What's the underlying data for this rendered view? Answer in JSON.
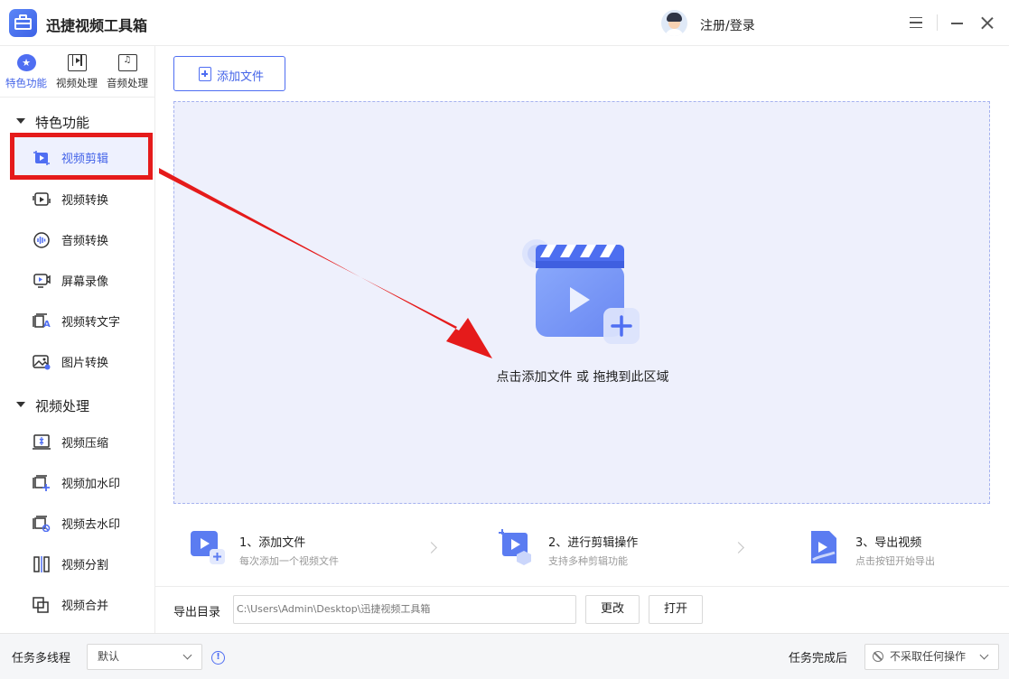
{
  "app": {
    "title": "迅捷视频工具箱",
    "login": "注册/登录"
  },
  "colors": {
    "accent": "#4f6ef2",
    "dropzone_bg": "#eef0fc",
    "annotation_red": "#e51b1b"
  },
  "topnav": [
    {
      "label": "特色功能",
      "icon": "star-icon",
      "active": true
    },
    {
      "label": "视频处理",
      "icon": "film-icon",
      "active": false
    },
    {
      "label": "音频处理",
      "icon": "music-icon",
      "active": false
    }
  ],
  "sidebar": {
    "groups": [
      {
        "title": "特色功能",
        "items": [
          {
            "label": "视频剪辑",
            "icon": "video-crop-icon",
            "active": true
          },
          {
            "label": "视频转换",
            "icon": "video-convert-icon"
          },
          {
            "label": "音频转换",
            "icon": "audio-wave-icon"
          },
          {
            "label": "屏幕录像",
            "icon": "screen-record-icon"
          },
          {
            "label": "视频转文字",
            "icon": "video-to-text-icon"
          },
          {
            "label": "图片转换",
            "icon": "image-convert-icon"
          }
        ]
      },
      {
        "title": "视频处理",
        "items": [
          {
            "label": "视频压缩",
            "icon": "video-compress-icon"
          },
          {
            "label": "视频加水印",
            "icon": "add-watermark-icon"
          },
          {
            "label": "视频去水印",
            "icon": "remove-watermark-icon"
          },
          {
            "label": "视频分割",
            "icon": "video-split-icon"
          },
          {
            "label": "视频合并",
            "icon": "video-merge-icon"
          }
        ]
      }
    ]
  },
  "main": {
    "add_button": "添加文件",
    "drop_text": "点击添加文件 或 拖拽到此区域",
    "steps": [
      {
        "title": "1、添加文件",
        "desc": "每次添加一个视频文件"
      },
      {
        "title": "2、进行剪辑操作",
        "desc": "支持多种剪辑功能"
      },
      {
        "title": "3、导出视频",
        "desc": "点击按钮开始导出"
      }
    ],
    "output": {
      "label": "导出目录",
      "path": "C:\\Users\\Admin\\Desktop\\迅捷视频工具箱",
      "change_button": "更改",
      "open_button": "打开"
    }
  },
  "bottom": {
    "multithread_label": "任务多线程",
    "multithread_value": "默认",
    "after_label": "任务完成后",
    "after_value": "不采取任何操作"
  }
}
